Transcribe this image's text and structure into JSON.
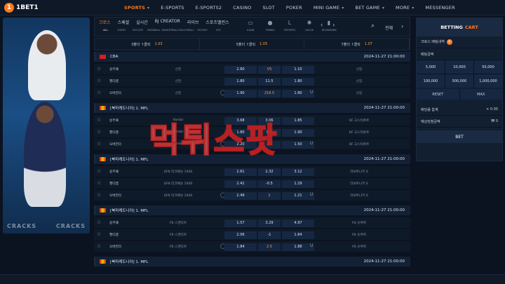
{
  "header": {
    "logo": "1BET1",
    "nav": [
      {
        "label": "SPORTS",
        "active": true,
        "dropdown": true
      },
      {
        "label": "E-SPORTS",
        "active": false,
        "dropdown": false
      },
      {
        "label": "E-SPORTS2",
        "active": false,
        "dropdown": false
      },
      {
        "label": "CASINO",
        "active": false,
        "dropdown": false
      },
      {
        "label": "SLOT",
        "active": false,
        "dropdown": false
      },
      {
        "label": "POKER",
        "active": false,
        "dropdown": false
      },
      {
        "label": "MINI GAME",
        "active": false,
        "dropdown": true
      },
      {
        "label": "BET GAME",
        "active": false,
        "dropdown": true
      },
      {
        "label": "MORE",
        "active": false,
        "dropdown": true
      },
      {
        "label": "MESSENGER",
        "active": false,
        "dropdown": false
      }
    ]
  },
  "banner": {
    "left_text": "CRACKS",
    "right_text": "CRACKS"
  },
  "sports": {
    "tabs": [
      "크로스",
      "스페셜",
      "실시간",
      "BJ CREATOR",
      "라이브",
      "스포츠벨런스"
    ],
    "subtabs": [
      "ALL",
      "EVENT",
      "SOCCER",
      "BASEBALL",
      "BASKETBALL",
      "VOLLEYBALL",
      "HOCKEY",
      "UFC"
    ],
    "icons": [
      {
        "label": "ILSAN",
        "icon": "ilsan-icon"
      },
      {
        "label": "TENNIS",
        "icon": "tennis-icon"
      },
      {
        "label": "ESPORTS",
        "icon": "esports-icon"
      },
      {
        "label": "GULSE",
        "icon": "gulse-icon"
      },
      {
        "label": "BOOKMARK",
        "icon": "bookmark-icon"
      }
    ],
    "all_label": "전체"
  },
  "combo": [
    {
      "label": "3폴더 ↑클릭",
      "value": "1.03"
    },
    {
      "label": "5폴더 ↑클릭",
      "value": "1.05"
    },
    {
      "label": "7폴더 ↑클릭",
      "value": "1.07"
    }
  ],
  "leagues": [
    {
      "name": "CBA",
      "date": "2024-11-27 21:00:00",
      "flag": "china",
      "rows": [
        {
          "market": "승무패",
          "home": "선전",
          "o1": "2.60",
          "draw": "VS",
          "o2": "1.10",
          "away": "신장",
          "draw_highlight": true
        },
        {
          "market": "핸디캡",
          "home": "선전",
          "o1": "1.80",
          "draw": "11.5",
          "o2": "1.80",
          "away": "신장",
          "draw_highlight": false
        },
        {
          "market": "오버언더",
          "home": "선전",
          "o1": "1.90",
          "draw": "216.5",
          "o2": "1.80",
          "away": "신장",
          "draw_highlight": true
        }
      ]
    },
    {
      "name": "[북마케도니아] 1. MFL",
      "date": "2024-11-27 21:00:00",
      "flag": "macedonia",
      "rows": [
        {
          "market": "승무패",
          "home": "Vardar",
          "o1": "3.68",
          "draw": "3.06",
          "o2": "1.85",
          "away": "KF 고스티바르",
          "draw_highlight": false
        },
        {
          "market": "핸디캡",
          "home": "Vardar",
          "o1": "1.80",
          "draw": "0.5",
          "o2": "1.90",
          "away": "KF 고스티바르",
          "draw_highlight": false
        },
        {
          "market": "오버언더",
          "home": "Vardar",
          "o1": "2.20",
          "draw": "2.5",
          "o2": "1.50",
          "away": "KF 고스티바르",
          "draw_highlight": true
        }
      ]
    },
    {
      "name": "[북마케도니아] 1. MFL",
      "date": "2024-11-27 21:00:00",
      "flag": "macedonia",
      "rows": [
        {
          "market": "승무패",
          "home": "GFK 티크베슈 1930",
          "o1": "2.61",
          "draw": "2.32",
          "o2": "3.12",
          "away": "라보트니키 S",
          "draw_highlight": false
        },
        {
          "market": "핸디캡",
          "home": "GFK 티크베슈 1930",
          "o1": "2.41",
          "draw": "-0.5",
          "o2": "1.29",
          "away": "라보트니키 S",
          "draw_highlight": false
        },
        {
          "market": "오버언더",
          "home": "GFK 티크베슈 1930",
          "o1": "2.49",
          "draw": "2",
          "o2": "1.21",
          "away": "라보트니키 S",
          "draw_highlight": true
        }
      ]
    },
    {
      "name": "[북마케도니아] 1. MFL",
      "date": "2024-11-27 21:00:00",
      "flag": "macedonia",
      "rows": [
        {
          "market": "승무패",
          "home": "FK 스켄디아",
          "o1": "1.57",
          "draw": "3.29",
          "o2": "4.97",
          "away": "FK 슈쿠피",
          "draw_highlight": false
        },
        {
          "market": "핸디캡",
          "home": "FK 스켄디아",
          "o1": "2.06",
          "draw": "-1",
          "o2": "1.64",
          "away": "FK 슈쿠피",
          "draw_highlight": false
        },
        {
          "market": "오버언더",
          "home": "FK 스켄디아",
          "o1": "1.84",
          "draw": "2.5",
          "o2": "1.88",
          "away": "FK 슈쿠피",
          "draw_highlight": true
        }
      ]
    },
    {
      "name": "[북마케도니아] 1. MFL",
      "date": "2024-11-27 21:00:00",
      "flag": "macedonia",
      "rows": []
    }
  ],
  "betslip": {
    "title": "BETTING",
    "title_accent": "CART",
    "cross_label": "크로스 배팅내역",
    "cross_count": "0",
    "amount_label": "배팅금액",
    "amounts": [
      "5,000",
      "10,000",
      "50,000",
      "100,000",
      "500,000",
      "1,000,000"
    ],
    "reset": "RESET",
    "max": "MAX",
    "odds_total_label": "배당률 합계",
    "odds_total": "× 0.00",
    "expected_label": "예상당첨금액",
    "expected": "₩ 0",
    "bet": "BET"
  },
  "watermark": {
    "left": "먹튀",
    "right": "스팟"
  },
  "colors": {
    "accent": "#ff7a1a",
    "bg": "#0b1320",
    "panel": "#0f1a29"
  }
}
